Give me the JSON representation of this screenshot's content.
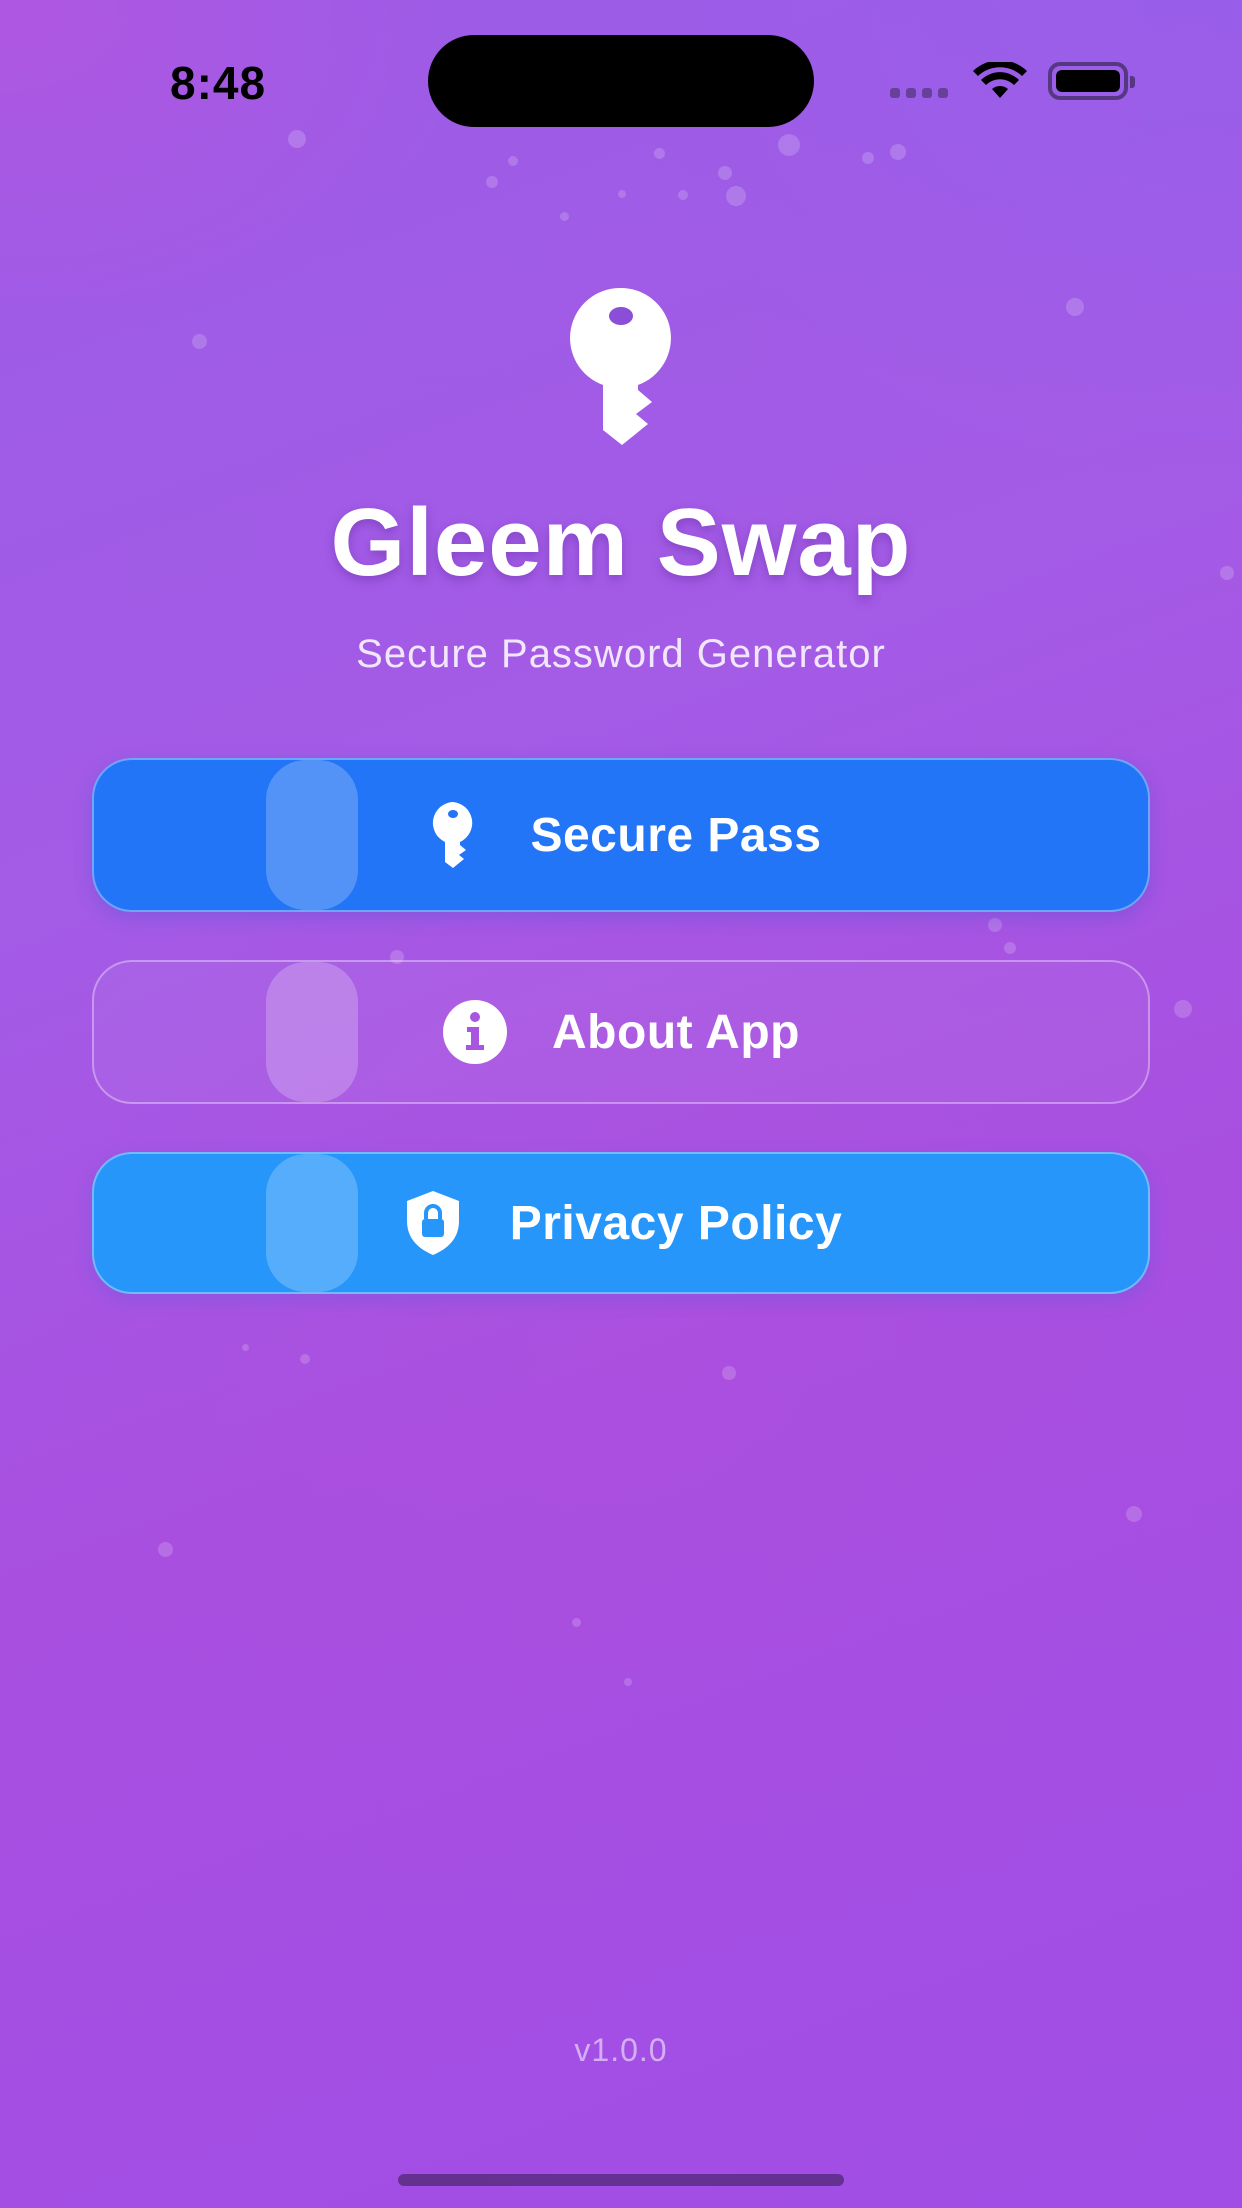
{
  "status_bar": {
    "time": "8:48"
  },
  "header": {
    "logo_icon": "key-icon",
    "title": "Gleem Swap",
    "subtitle": "Secure Password Generator"
  },
  "menu": [
    {
      "label": "Secure Pass",
      "icon": "key-icon",
      "color": "#2375f7"
    },
    {
      "label": "About App",
      "icon": "info-icon",
      "color": "transparent"
    },
    {
      "label": "Privacy Policy",
      "icon": "shield-lock-icon",
      "color": "#2796fa"
    }
  ],
  "footer": {
    "version": "v1.0.0"
  }
}
